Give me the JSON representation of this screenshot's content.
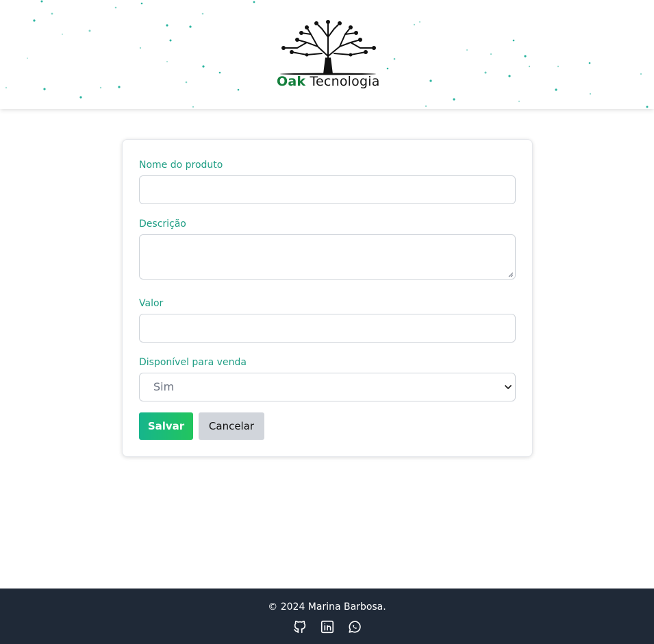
{
  "brand": {
    "name_primary": "Oak",
    "name_secondary": "Tecnologia",
    "logo_icon": "tree-circuit-icon",
    "accent_color": "#1f9e84",
    "brand_green": "#15803d"
  },
  "form": {
    "product_name_label": "Nome do produto",
    "product_name_value": "",
    "description_label": "Descrição",
    "description_value": "",
    "price_label": "Valor",
    "price_value": "",
    "available_label": "Disponível para venda",
    "available_selected": "Sim",
    "save_label": "Salvar",
    "cancel_label": "Cancelar"
  },
  "footer": {
    "copyright": "© 2024 Marina Barbosa.",
    "background": "#1f2937",
    "icons": [
      "github-icon",
      "linkedin-icon",
      "whatsapp-icon"
    ]
  }
}
